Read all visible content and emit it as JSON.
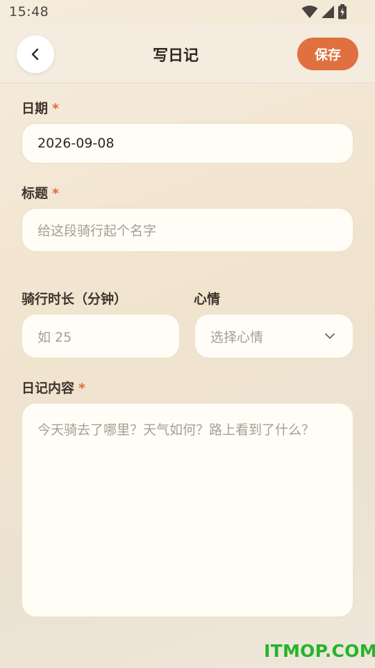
{
  "status_bar": {
    "time": "15:48",
    "icons": [
      "wifi-icon",
      "signal-icon",
      "battery-charging-icon"
    ]
  },
  "header": {
    "back_icon": "chevron-left-icon",
    "title": "写日记",
    "save_label": "保存",
    "accent_color": "#e07040"
  },
  "form": {
    "date": {
      "label": "日期",
      "required_mark": "*",
      "value": "2026-09-08"
    },
    "title": {
      "label": "标题",
      "required_mark": "*",
      "placeholder": "给这段骑行起个名字"
    },
    "duration": {
      "label": "骑行时长（分钟）",
      "placeholder": "如 25"
    },
    "mood": {
      "label": "心情",
      "placeholder": "选择心情",
      "icon": "chevron-down-icon"
    },
    "content": {
      "label": "日记内容",
      "required_mark": "*",
      "placeholder": "今天骑去了哪里？天气如何？路上看到了什么？"
    }
  },
  "watermark": "ITMOP.COM"
}
